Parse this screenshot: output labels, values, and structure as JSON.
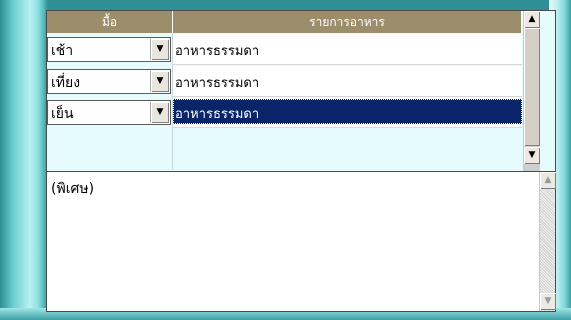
{
  "grid": {
    "headers": {
      "meal": "มื้อ",
      "food": "รายการอาหาร"
    },
    "rows": [
      {
        "meal": "เช้า",
        "food": "อาหารธรรมดา",
        "selected": false
      },
      {
        "meal": "เที่ยง",
        "food": "อาหารธรรมดา",
        "selected": false
      },
      {
        "meal": "เย็น",
        "food": "อาหารธรรมดา",
        "selected": true
      }
    ]
  },
  "notes": {
    "text": "(พิเศษ)"
  },
  "icons": {
    "dropdown": "chevron-down-icon",
    "scroll_up": "arrow-up-icon",
    "scroll_down": "arrow-down-icon"
  },
  "colors": {
    "header_bg": "#9c8e6b",
    "selection_bg": "#0a246a",
    "grid_bg": "#e6fbfd",
    "frame_teal": "#4fb7bb"
  }
}
